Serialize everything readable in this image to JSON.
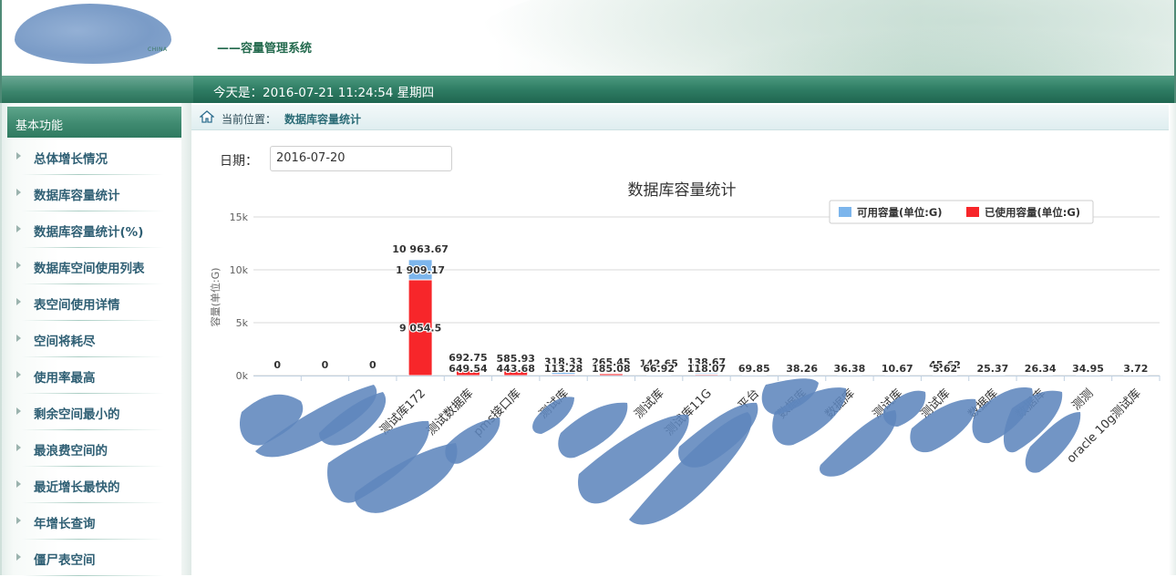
{
  "header": {
    "logo_caption": "CHINA",
    "system_title": "——容量管理系统"
  },
  "datebar": {
    "text": "今天是：2016-07-21 11:24:54   星期四"
  },
  "sidebar": {
    "title": "基本功能",
    "items": [
      {
        "label": "总体增长情况"
      },
      {
        "label": "数据库容量统计"
      },
      {
        "label": "数据库容量统计(%)"
      },
      {
        "label": "数据库空间使用列表"
      },
      {
        "label": "表空间使用详情"
      },
      {
        "label": "空间将耗尽"
      },
      {
        "label": "使用率最高"
      },
      {
        "label": "剩余空间最小的"
      },
      {
        "label": "最浪费空间的"
      },
      {
        "label": "最近增长最快的"
      },
      {
        "label": "年增长查询"
      },
      {
        "label": "僵尸表空间"
      }
    ]
  },
  "breadcrumb": {
    "label": "当前位置：",
    "current": "数据库容量统计"
  },
  "filter": {
    "date_label": "日期：",
    "date_value": "2016-07-20"
  },
  "colors": {
    "available": "#7cb5ec",
    "used": "#f7262a",
    "accent": "#2f7a60"
  },
  "chart_data": {
    "type": "bar",
    "stacked": true,
    "title": "数据库容量统计",
    "ylabel": "容量(单位:G)",
    "ylim": [
      0,
      15000
    ],
    "yticks": [
      "0k",
      "5k",
      "10k",
      "15k"
    ],
    "legend_position": "top-right",
    "categories": [
      "",
      "",
      "",
      "测试库172",
      "测试数据库",
      "pms接口库",
      "测试库",
      "",
      "测试库",
      "测试库11G",
      "平台",
      "数据库",
      "数据库",
      "测试库",
      "测试库",
      "数据库",
      "数据库",
      "测测",
      "oracle 10g测试库"
    ],
    "series": [
      {
        "name": "可用容量(单位:G)",
        "values": [
          0,
          0,
          0,
          1909.17,
          43.21,
          142.25,
          205.05,
          80.37,
          75.73,
          120.6,
          35.0,
          20.0,
          20.0,
          5.0,
          8.0,
          10.0,
          12.0,
          10.0,
          2.0
        ]
      },
      {
        "name": "已使用容量(单位:G)",
        "values": [
          0,
          0,
          0,
          9054.5,
          649.54,
          443.68,
          113.28,
          185.08,
          66.92,
          118.07,
          69.85,
          38.26,
          36.38,
          10.67,
          5.62,
          25.37,
          26.34,
          34.95,
          3.72
        ]
      }
    ],
    "total_labels": [
      "0",
      "0",
      "0",
      "10 963.67",
      "692.75",
      "585.93",
      "318.33",
      "265.45",
      "142.65",
      "138.67",
      "",
      "",
      "",
      "",
      "45.62",
      "",
      "",
      "",
      ""
    ],
    "available_labels": [
      "",
      "",
      "",
      "1 909.17",
      "",
      "",
      "",
      "",
      "",
      "",
      "",
      "",
      "",
      "",
      "",
      "",
      "",
      "",
      ""
    ],
    "used_labels": [
      "",
      "",
      "",
      "9 054.5",
      "649.54",
      "443.68",
      "113.28",
      "185.08",
      "66.92",
      "118.07",
      "69.85",
      "38.26",
      "36.38",
      "10.67",
      "5.62",
      "25.37",
      "26.34",
      "34.95",
      "3.72"
    ]
  }
}
